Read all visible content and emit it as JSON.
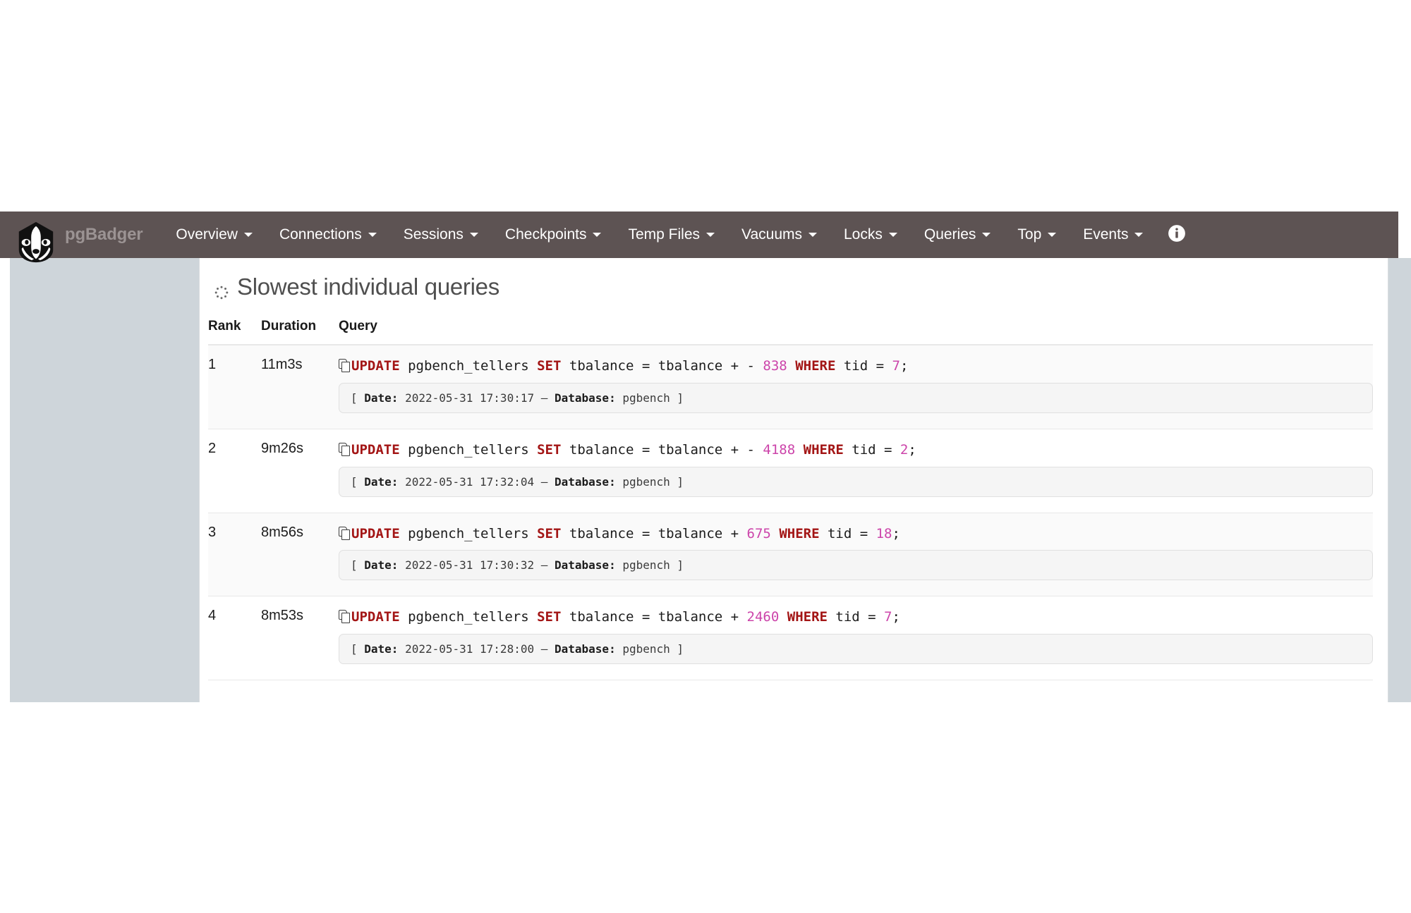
{
  "navbar": {
    "brand": "pgBadger",
    "logo_icon": "badger-logo-icon",
    "items": [
      {
        "label": "Overview",
        "caret": true
      },
      {
        "label": "Connections",
        "caret": true
      },
      {
        "label": "Sessions",
        "caret": true
      },
      {
        "label": "Checkpoints",
        "caret": true
      },
      {
        "label": "Temp Files",
        "caret": true
      },
      {
        "label": "Vacuums",
        "caret": true
      },
      {
        "label": "Locks",
        "caret": true
      },
      {
        "label": "Queries",
        "caret": true
      },
      {
        "label": "Top",
        "caret": true
      },
      {
        "label": "Events",
        "caret": true
      }
    ],
    "info_icon": "info-circle-icon",
    "background_color": "#5d5353",
    "brand_color": "#9b9393"
  },
  "main": {
    "title": "Slowest individual queries",
    "title_icon": "spinner-icon",
    "table": {
      "headers": [
        "Rank",
        "Duration",
        "Query"
      ],
      "rows": [
        {
          "rank": "1",
          "duration": "11m3s",
          "copy_icon": "copy-icon",
          "query_tokens": [
            {
              "t": "UPDATE",
              "k": "kw"
            },
            {
              "t": " pgbench_tellers ",
              "k": ""
            },
            {
              "t": "SET",
              "k": "kw"
            },
            {
              "t": " tbalance = tbalance + - ",
              "k": ""
            },
            {
              "t": "838",
              "k": "num"
            },
            {
              "t": " ",
              "k": ""
            },
            {
              "t": "WHERE",
              "k": "kw"
            },
            {
              "t": " tid = ",
              "k": ""
            },
            {
              "t": "7",
              "k": "num"
            },
            {
              "t": ";",
              "k": ""
            }
          ],
          "meta": {
            "date_label": "Date:",
            "date_value": "2022-05-31 17:30:17",
            "separator": "–",
            "db_label": "Database:",
            "db_value": "pgbench"
          }
        },
        {
          "rank": "2",
          "duration": "9m26s",
          "copy_icon": "copy-icon",
          "query_tokens": [
            {
              "t": "UPDATE",
              "k": "kw"
            },
            {
              "t": " pgbench_tellers ",
              "k": ""
            },
            {
              "t": "SET",
              "k": "kw"
            },
            {
              "t": " tbalance = tbalance + - ",
              "k": ""
            },
            {
              "t": "4188",
              "k": "num"
            },
            {
              "t": " ",
              "k": ""
            },
            {
              "t": "WHERE",
              "k": "kw"
            },
            {
              "t": " tid = ",
              "k": ""
            },
            {
              "t": "2",
              "k": "num"
            },
            {
              "t": ";",
              "k": ""
            }
          ],
          "meta": {
            "date_label": "Date:",
            "date_value": "2022-05-31 17:32:04",
            "separator": "–",
            "db_label": "Database:",
            "db_value": "pgbench"
          }
        },
        {
          "rank": "3",
          "duration": "8m56s",
          "copy_icon": "copy-icon",
          "query_tokens": [
            {
              "t": "UPDATE",
              "k": "kw"
            },
            {
              "t": " pgbench_tellers ",
              "k": ""
            },
            {
              "t": "SET",
              "k": "kw"
            },
            {
              "t": " tbalance = tbalance + ",
              "k": ""
            },
            {
              "t": "675",
              "k": "num"
            },
            {
              "t": " ",
              "k": ""
            },
            {
              "t": "WHERE",
              "k": "kw"
            },
            {
              "t": " tid = ",
              "k": ""
            },
            {
              "t": "18",
              "k": "num"
            },
            {
              "t": ";",
              "k": ""
            }
          ],
          "meta": {
            "date_label": "Date:",
            "date_value": "2022-05-31 17:30:32",
            "separator": "–",
            "db_label": "Database:",
            "db_value": "pgbench"
          }
        },
        {
          "rank": "4",
          "duration": "8m53s",
          "copy_icon": "copy-icon",
          "query_tokens": [
            {
              "t": "UPDATE",
              "k": "kw"
            },
            {
              "t": " pgbench_tellers ",
              "k": ""
            },
            {
              "t": "SET",
              "k": "kw"
            },
            {
              "t": " tbalance = tbalance + ",
              "k": ""
            },
            {
              "t": "2460",
              "k": "num"
            },
            {
              "t": " ",
              "k": ""
            },
            {
              "t": "WHERE",
              "k": "kw"
            },
            {
              "t": " tid = ",
              "k": ""
            },
            {
              "t": "7",
              "k": "num"
            },
            {
              "t": ";",
              "k": ""
            }
          ],
          "meta": {
            "date_label": "Date:",
            "date_value": "2022-05-31 17:28:00",
            "separator": "–",
            "db_label": "Database:",
            "db_value": "pgbench"
          }
        }
      ]
    }
  },
  "theme": {
    "keyword_color": "#a31515",
    "number_color": "#cc44aa",
    "rail_color": "#ced5da",
    "row_stripe_color": "#fafafa"
  }
}
